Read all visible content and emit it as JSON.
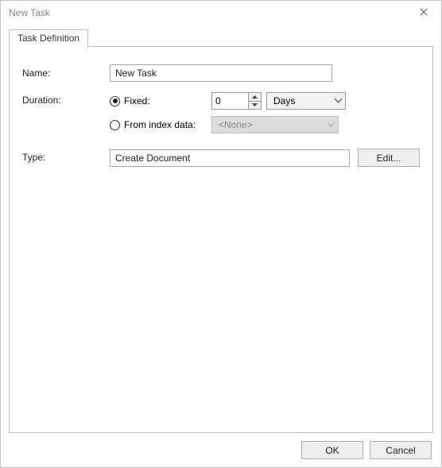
{
  "window": {
    "title": "New Task"
  },
  "tabs": {
    "definition": "Task Definition"
  },
  "labels": {
    "name": "Name:",
    "duration": "Duration:",
    "type": "Type:"
  },
  "fields": {
    "name_value": "New Task",
    "type_value": "Create Document"
  },
  "duration": {
    "fixed_label": "Fixed:",
    "from_index_label": "From index data:",
    "fixed_value": "0",
    "unit_value": "Days",
    "index_value": "<None>"
  },
  "buttons": {
    "edit": "Edit...",
    "ok": "OK",
    "cancel": "Cancel"
  }
}
